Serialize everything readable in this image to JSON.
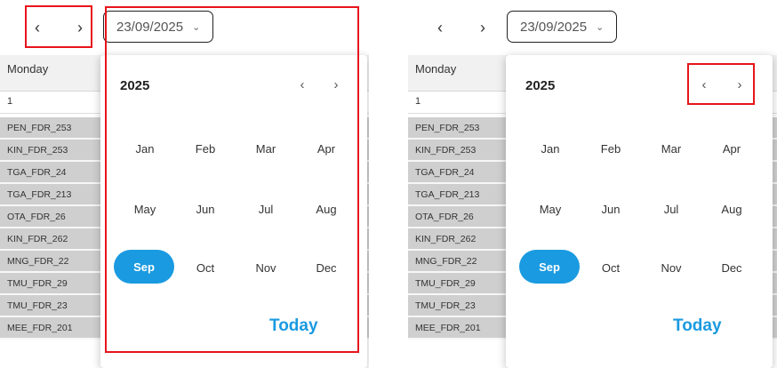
{
  "date_picker": {
    "value": "23/09/2025",
    "year": "2025",
    "months": [
      "Jan",
      "Feb",
      "Mar",
      "Apr",
      "May",
      "Jun",
      "Jul",
      "Aug",
      "Sep",
      "Oct",
      "Nov",
      "Dec"
    ],
    "selected_month": "Sep",
    "today_label": "Today"
  },
  "nav": {
    "prev_glyph": "‹",
    "next_glyph": "›",
    "chevron_glyph": "⌄"
  },
  "table": {
    "day_header": "Monday",
    "day_number": "1",
    "rows": [
      "PEN_FDR_253",
      "KIN_FDR_253",
      "TGA_FDR_24",
      "TGA_FDR_213",
      "OTA_FDR_26",
      "KIN_FDR_262",
      "MNG_FDR_22",
      "TMU_FDR_29",
      "TMU_FDR_23",
      "MEE_FDR_201"
    ]
  },
  "colors": {
    "accent": "#1a9ae0",
    "highlight": "#e8141b"
  }
}
